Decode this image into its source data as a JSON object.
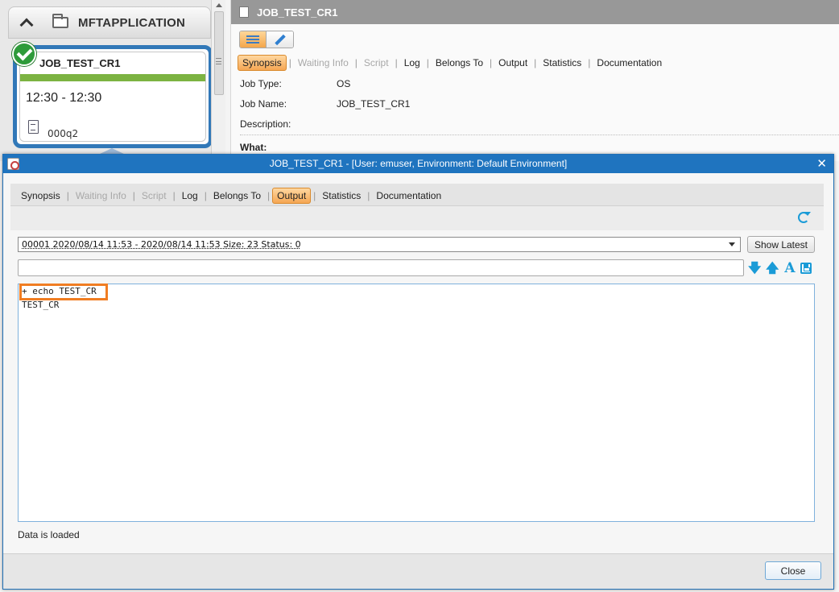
{
  "folder": {
    "title": "MFTAPPLICATION"
  },
  "job_card": {
    "title": "JOB_TEST_CR1",
    "time": "12:30 - 12:30",
    "count": "000q2"
  },
  "details": {
    "title": "JOB_TEST_CR1",
    "tabs": [
      {
        "label": "Synopsis",
        "state": "active"
      },
      {
        "label": "Waiting Info",
        "state": "disabled"
      },
      {
        "label": "Script",
        "state": "disabled"
      },
      {
        "label": "Log",
        "state": "normal"
      },
      {
        "label": "Belongs To",
        "state": "normal"
      },
      {
        "label": "Output",
        "state": "normal"
      },
      {
        "label": "Statistics",
        "state": "normal"
      },
      {
        "label": "Documentation",
        "state": "normal"
      }
    ],
    "synopsis": {
      "job_type_label": "Job Type:",
      "job_type_value": "OS",
      "job_name_label": "Job Name:",
      "job_name_value": "JOB_TEST_CR1",
      "description_label": "Description:",
      "what_label": "What:"
    }
  },
  "dialog": {
    "title": "JOB_TEST_CR1 - [User: emuser, Environment: Default Environment]",
    "close_glyph": "✕",
    "tabs": [
      {
        "label": "Synopsis",
        "state": "normal"
      },
      {
        "label": "Waiting Info",
        "state": "disabled"
      },
      {
        "label": "Script",
        "state": "disabled"
      },
      {
        "label": "Log",
        "state": "normal"
      },
      {
        "label": "Belongs To",
        "state": "normal"
      },
      {
        "label": "Output",
        "state": "active"
      },
      {
        "label": "Statistics",
        "state": "normal"
      },
      {
        "label": "Documentation",
        "state": "normal"
      }
    ],
    "run_select": "00001 2020/08/14 11:53 - 2020/08/14 11:53 Size: 23 Status: 0",
    "show_latest": "Show Latest",
    "search_value": "",
    "icons": {
      "down": "🡇",
      "up": "🡅",
      "font": "A"
    },
    "output_lines": [
      "+ echo TEST_CR",
      "TEST_CR"
    ],
    "status": "Data is loaded",
    "close_label": "Close"
  },
  "colors": {
    "accent": "#1f74bf",
    "active_tab": "#f5a653",
    "highlight": "#f07d22",
    "success": "#7cb342"
  }
}
